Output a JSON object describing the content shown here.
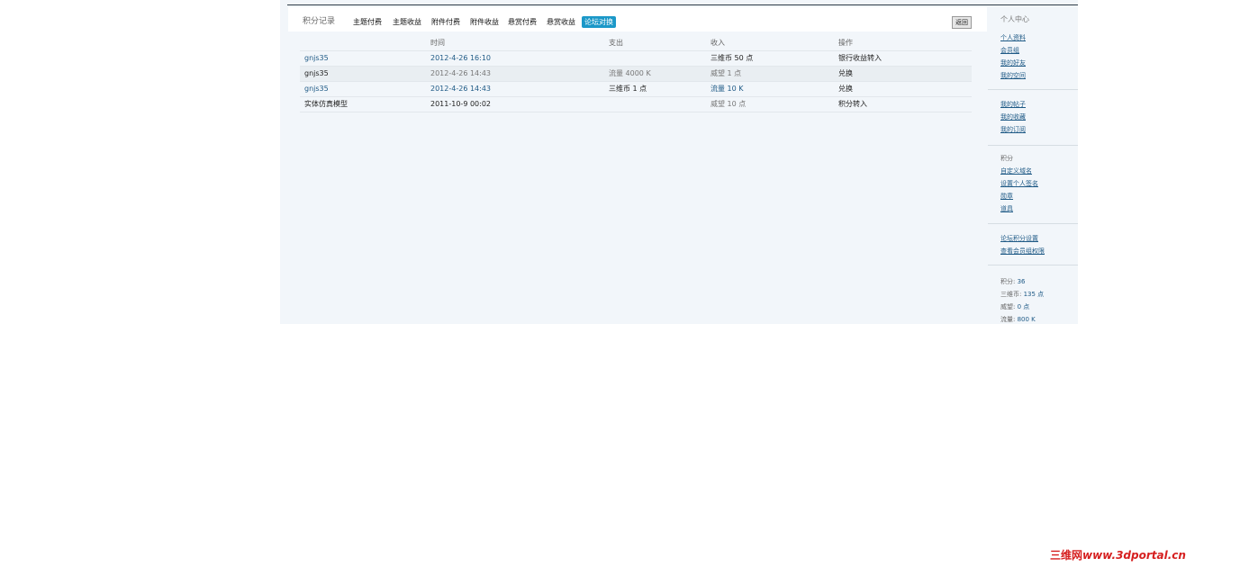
{
  "tabs": {
    "title": "积分记录",
    "items": [
      "主题付费",
      "主题收益",
      "附件付费",
      "附件收益",
      "悬赏付费",
      "悬赏收益",
      "论坛对换"
    ],
    "active_index": 6,
    "return_label": "返回"
  },
  "table": {
    "headers": [
      "",
      "时间",
      "支出",
      "收入",
      "操作"
    ],
    "rows": [
      [
        "gnjs35",
        "2012-4-26 16:10",
        "",
        "三维币 50 点",
        "银行收益转入"
      ],
      [
        "gnjs35",
        "2012-4-26 14:43",
        "流量 4000 K",
        "威望 1 点",
        "兑换"
      ],
      [
        "gnjs35",
        "2012-4-26 14:43",
        "三维币 1 点",
        "流量 10 K",
        "兑换"
      ],
      [
        "实体仿真模型",
        "2011-10-9 00:02",
        "",
        "威望 10 点",
        "积分转入"
      ]
    ]
  },
  "sidebar": {
    "group1_title": "个人中心",
    "group1_items": [
      "个人资料",
      "会员组",
      "我的好友",
      "我的空间"
    ],
    "group2_items": [
      "我的帖子",
      "我的收藏",
      "我的订阅"
    ],
    "group3_items": [
      "积分",
      "自定义域名",
      "设置个人签名",
      "勋章",
      "道具"
    ],
    "group4_items": [
      "论坛积分设置",
      "查看会员组权限"
    ],
    "stats": [
      {
        "label": "积分:",
        "value": "36"
      },
      {
        "label": "三维币:",
        "value": "135 点"
      },
      {
        "label": "威望:",
        "value": "0 点"
      },
      {
        "label": "流量:",
        "value": "800 K"
      }
    ]
  },
  "watermark": {
    "cn": "三维网",
    "url": "www.3dportal.cn"
  }
}
